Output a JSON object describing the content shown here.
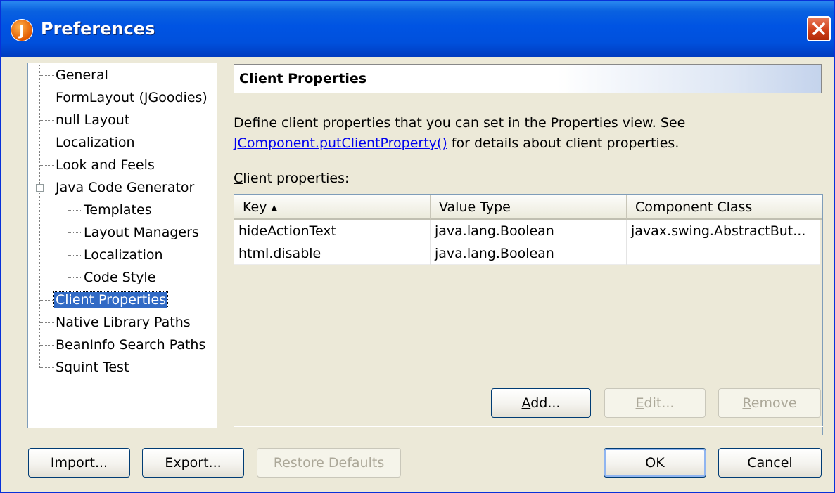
{
  "window": {
    "title": "Preferences",
    "app_icon_letter": "J"
  },
  "tree": {
    "items": [
      {
        "label": "General"
      },
      {
        "label": "FormLayout (JGoodies)"
      },
      {
        "label": "null Layout"
      },
      {
        "label": "Localization"
      },
      {
        "label": "Look and Feels"
      },
      {
        "label": "Java Code Generator",
        "expanded": true
      },
      {
        "label": "Templates"
      },
      {
        "label": "Layout Managers"
      },
      {
        "label": "Localization"
      },
      {
        "label": "Code Style"
      },
      {
        "label": "Client Properties",
        "selected": true
      },
      {
        "label": "Native Library Paths"
      },
      {
        "label": "BeanInfo Search Paths"
      },
      {
        "label": "Squint Test"
      }
    ]
  },
  "panel": {
    "title": "Client Properties",
    "description_line1": "Define client properties that you can set in the Properties view. See",
    "description_link": "JComponent.putClientProperty()",
    "description_line2_rest": " for details about client properties.",
    "props_label_mnemonic": "C",
    "props_label_rest": "lient properties:"
  },
  "table": {
    "columns": [
      "Key",
      "Value Type",
      "Component Class"
    ],
    "sort_indicator": "▲",
    "rows": [
      [
        "hideActionText",
        "java.lang.Boolean",
        "javax.swing.AbstractBut..."
      ],
      [
        "html.disable",
        "java.lang.Boolean",
        ""
      ]
    ]
  },
  "table_buttons": {
    "add_mnemonic": "A",
    "add_rest": "dd...",
    "edit_mnemonic": "E",
    "edit_rest": "dit...",
    "remove_mnemonic": "R",
    "remove_rest": "emove"
  },
  "footer": {
    "import": "Import...",
    "export": "Export...",
    "restore_defaults": "Restore Defaults",
    "ok": "OK",
    "cancel": "Cancel"
  }
}
